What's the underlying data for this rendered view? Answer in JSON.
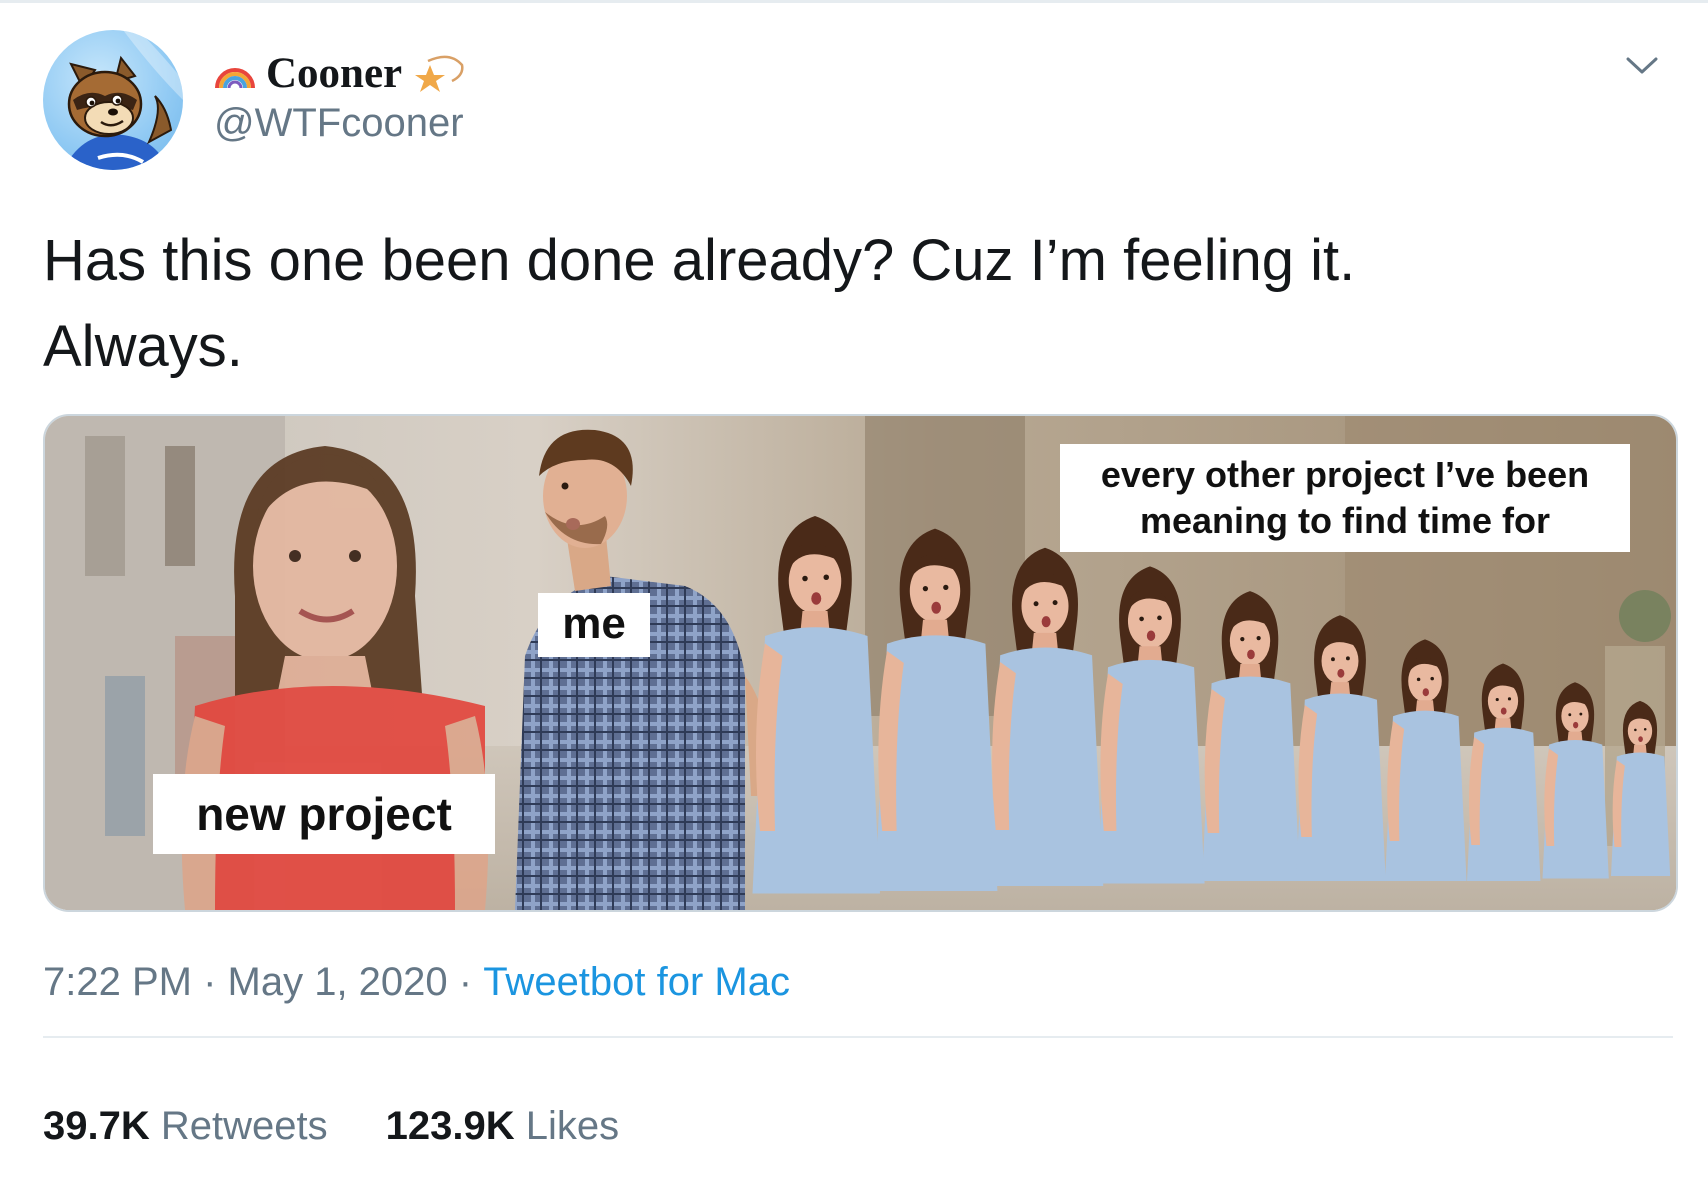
{
  "tweet": {
    "author": {
      "display_name": "Cooner",
      "handle": "@WTFcooner",
      "name_prefix_icon": "rainbow-icon",
      "name_suffix_icon": "shooting-star-icon"
    },
    "text_lines": [
      "Has this one been done already? Cuz I’m feeling it.",
      "Always."
    ],
    "menu_icon": "chevron-down-icon",
    "media": {
      "labels": {
        "new_project": "new project",
        "me": "me",
        "other_projects_line1": "every other project I’ve been",
        "other_projects_line2": "meaning to find time for"
      }
    },
    "meta": {
      "time": "7:22 PM",
      "separator": " · ",
      "date": "May 1, 2020",
      "source": "Tweetbot for Mac"
    },
    "stats": {
      "retweets_count": "39.7K",
      "retweets_label": "Retweets",
      "likes_count": "123.9K",
      "likes_label": "Likes"
    }
  },
  "colors": {
    "text_primary": "#14171a",
    "text_secondary": "#657786",
    "link": "#1b95e0",
    "divider": "#e6ecf0"
  }
}
